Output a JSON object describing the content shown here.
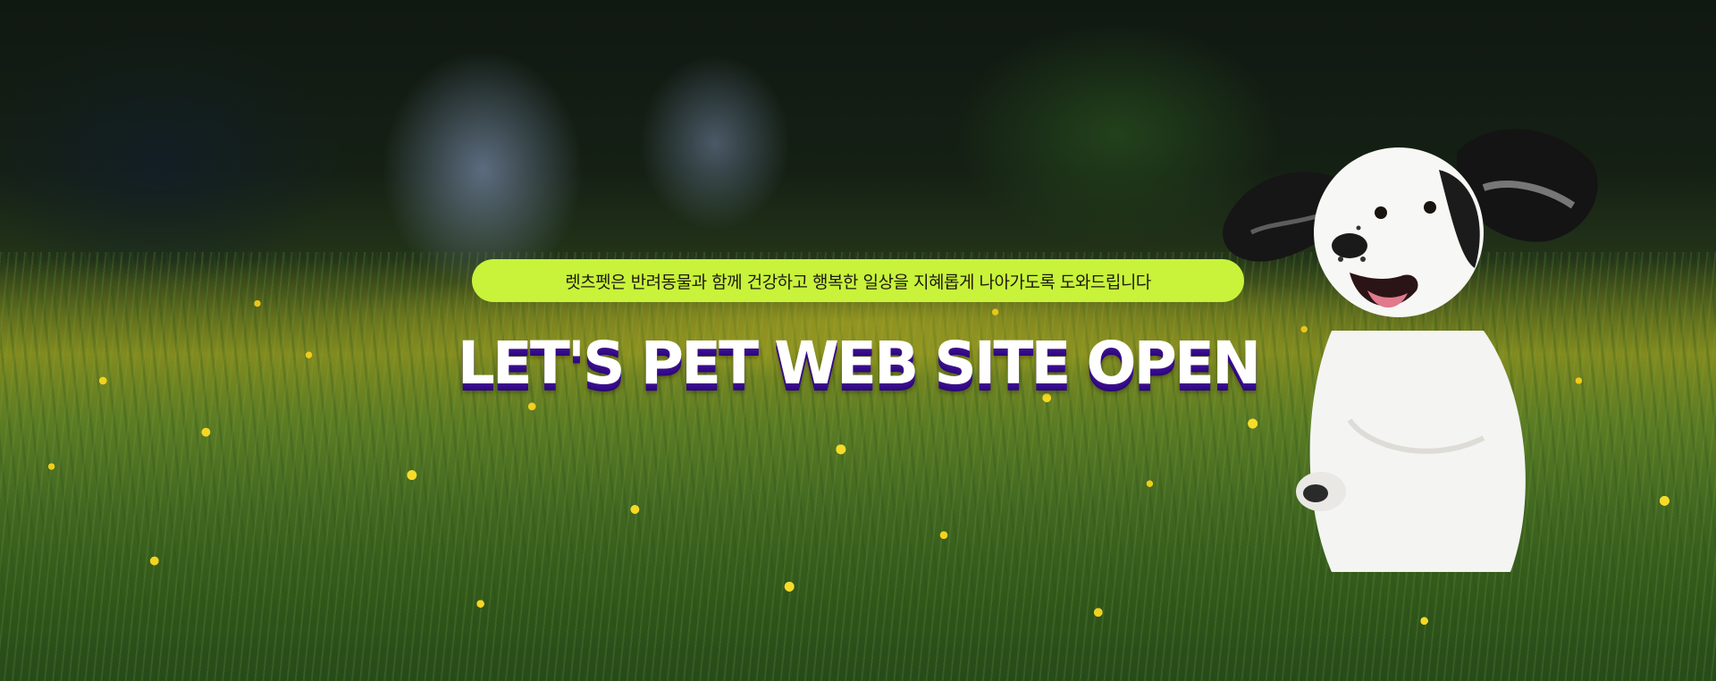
{
  "banner": {
    "tagline": "렛츠펫은 반려동물과 함께 건강하고 행복한 일상을 지혜롭게 나아가도록 도와드립니다",
    "headline": "LET'S PET WEB SITE OPEN"
  },
  "colors": {
    "pill_background": "#c8f33a",
    "headline_text": "#ffffff",
    "headline_shadow": "#3a0e8a"
  },
  "images": {
    "background": "flower-meadow-photo",
    "subject": "running-spaniel-dog-photo"
  }
}
